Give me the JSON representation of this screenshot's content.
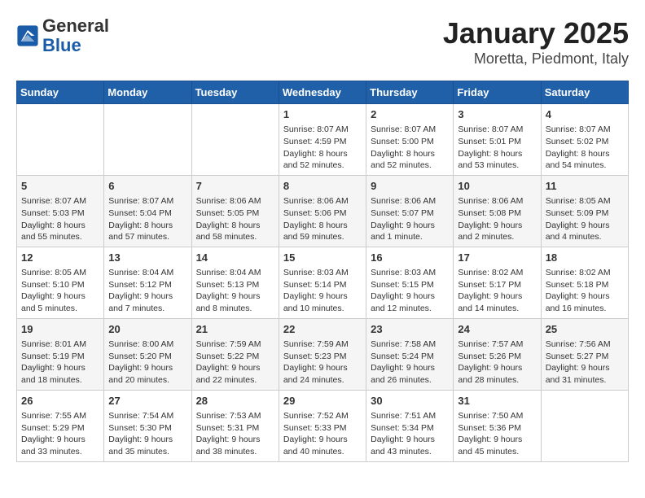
{
  "header": {
    "logo_general": "General",
    "logo_blue": "Blue",
    "title": "January 2025",
    "subtitle": "Moretta, Piedmont, Italy"
  },
  "weekdays": [
    "Sunday",
    "Monday",
    "Tuesday",
    "Wednesday",
    "Thursday",
    "Friday",
    "Saturday"
  ],
  "weeks": [
    [
      {
        "day": "",
        "info": ""
      },
      {
        "day": "",
        "info": ""
      },
      {
        "day": "",
        "info": ""
      },
      {
        "day": "1",
        "info": "Sunrise: 8:07 AM\nSunset: 4:59 PM\nDaylight: 8 hours and 52 minutes."
      },
      {
        "day": "2",
        "info": "Sunrise: 8:07 AM\nSunset: 5:00 PM\nDaylight: 8 hours and 52 minutes."
      },
      {
        "day": "3",
        "info": "Sunrise: 8:07 AM\nSunset: 5:01 PM\nDaylight: 8 hours and 53 minutes."
      },
      {
        "day": "4",
        "info": "Sunrise: 8:07 AM\nSunset: 5:02 PM\nDaylight: 8 hours and 54 minutes."
      }
    ],
    [
      {
        "day": "5",
        "info": "Sunrise: 8:07 AM\nSunset: 5:03 PM\nDaylight: 8 hours and 55 minutes."
      },
      {
        "day": "6",
        "info": "Sunrise: 8:07 AM\nSunset: 5:04 PM\nDaylight: 8 hours and 57 minutes."
      },
      {
        "day": "7",
        "info": "Sunrise: 8:06 AM\nSunset: 5:05 PM\nDaylight: 8 hours and 58 minutes."
      },
      {
        "day": "8",
        "info": "Sunrise: 8:06 AM\nSunset: 5:06 PM\nDaylight: 8 hours and 59 minutes."
      },
      {
        "day": "9",
        "info": "Sunrise: 8:06 AM\nSunset: 5:07 PM\nDaylight: 9 hours and 1 minute."
      },
      {
        "day": "10",
        "info": "Sunrise: 8:06 AM\nSunset: 5:08 PM\nDaylight: 9 hours and 2 minutes."
      },
      {
        "day": "11",
        "info": "Sunrise: 8:05 AM\nSunset: 5:09 PM\nDaylight: 9 hours and 4 minutes."
      }
    ],
    [
      {
        "day": "12",
        "info": "Sunrise: 8:05 AM\nSunset: 5:10 PM\nDaylight: 9 hours and 5 minutes."
      },
      {
        "day": "13",
        "info": "Sunrise: 8:04 AM\nSunset: 5:12 PM\nDaylight: 9 hours and 7 minutes."
      },
      {
        "day": "14",
        "info": "Sunrise: 8:04 AM\nSunset: 5:13 PM\nDaylight: 9 hours and 8 minutes."
      },
      {
        "day": "15",
        "info": "Sunrise: 8:03 AM\nSunset: 5:14 PM\nDaylight: 9 hours and 10 minutes."
      },
      {
        "day": "16",
        "info": "Sunrise: 8:03 AM\nSunset: 5:15 PM\nDaylight: 9 hours and 12 minutes."
      },
      {
        "day": "17",
        "info": "Sunrise: 8:02 AM\nSunset: 5:17 PM\nDaylight: 9 hours and 14 minutes."
      },
      {
        "day": "18",
        "info": "Sunrise: 8:02 AM\nSunset: 5:18 PM\nDaylight: 9 hours and 16 minutes."
      }
    ],
    [
      {
        "day": "19",
        "info": "Sunrise: 8:01 AM\nSunset: 5:19 PM\nDaylight: 9 hours and 18 minutes."
      },
      {
        "day": "20",
        "info": "Sunrise: 8:00 AM\nSunset: 5:20 PM\nDaylight: 9 hours and 20 minutes."
      },
      {
        "day": "21",
        "info": "Sunrise: 7:59 AM\nSunset: 5:22 PM\nDaylight: 9 hours and 22 minutes."
      },
      {
        "day": "22",
        "info": "Sunrise: 7:59 AM\nSunset: 5:23 PM\nDaylight: 9 hours and 24 minutes."
      },
      {
        "day": "23",
        "info": "Sunrise: 7:58 AM\nSunset: 5:24 PM\nDaylight: 9 hours and 26 minutes."
      },
      {
        "day": "24",
        "info": "Sunrise: 7:57 AM\nSunset: 5:26 PM\nDaylight: 9 hours and 28 minutes."
      },
      {
        "day": "25",
        "info": "Sunrise: 7:56 AM\nSunset: 5:27 PM\nDaylight: 9 hours and 31 minutes."
      }
    ],
    [
      {
        "day": "26",
        "info": "Sunrise: 7:55 AM\nSunset: 5:29 PM\nDaylight: 9 hours and 33 minutes."
      },
      {
        "day": "27",
        "info": "Sunrise: 7:54 AM\nSunset: 5:30 PM\nDaylight: 9 hours and 35 minutes."
      },
      {
        "day": "28",
        "info": "Sunrise: 7:53 AM\nSunset: 5:31 PM\nDaylight: 9 hours and 38 minutes."
      },
      {
        "day": "29",
        "info": "Sunrise: 7:52 AM\nSunset: 5:33 PM\nDaylight: 9 hours and 40 minutes."
      },
      {
        "day": "30",
        "info": "Sunrise: 7:51 AM\nSunset: 5:34 PM\nDaylight: 9 hours and 43 minutes."
      },
      {
        "day": "31",
        "info": "Sunrise: 7:50 AM\nSunset: 5:36 PM\nDaylight: 9 hours and 45 minutes."
      },
      {
        "day": "",
        "info": ""
      }
    ]
  ]
}
